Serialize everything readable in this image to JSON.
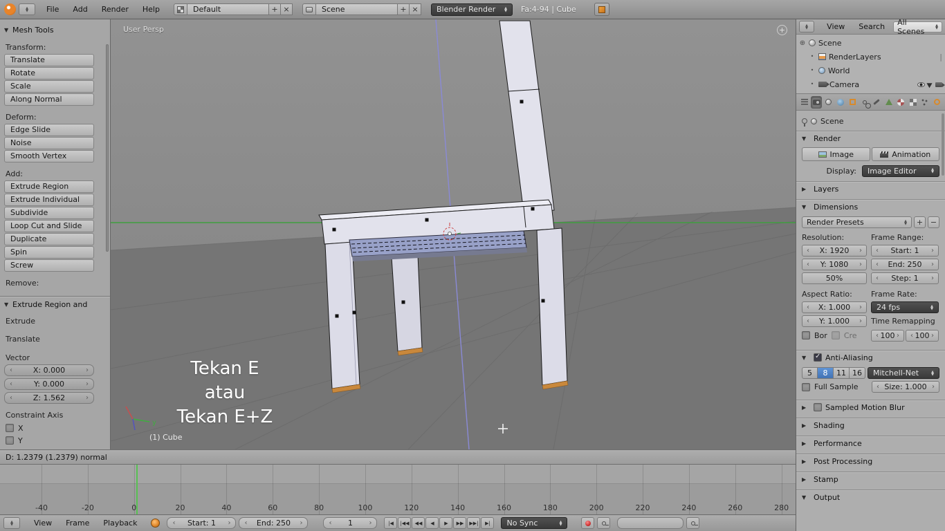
{
  "icons": {
    "panel_open": "▼",
    "panel_closed": "▶",
    "chevron_left": "‹",
    "chevron_right": "›",
    "plus": "+",
    "close": "×",
    "check": "✓"
  },
  "colors": {
    "accent_blue": "#4a7cc4",
    "selection_orange": "#c9883c",
    "axis_green": "#3e9e3e",
    "axis_blue": "#8a8ad6",
    "playhead_green": "#58c053",
    "record_red": "#c22727"
  },
  "top_bar": {
    "menus": [
      "File",
      "Add",
      "Render",
      "Help"
    ],
    "layout_name": "Default",
    "scene_name": "Scene",
    "engine": "Blender Render",
    "stats": "Fa:4-94 | Cube"
  },
  "tool_shelf": {
    "title": "Mesh Tools",
    "sections": [
      {
        "label": "Transform:",
        "buttons": [
          "Translate",
          "Rotate",
          "Scale",
          "Along Normal"
        ]
      },
      {
        "label": "Deform:",
        "buttons": [
          "Edge Slide",
          "Noise",
          "Smooth Vertex"
        ]
      },
      {
        "label": "Add:",
        "buttons": [
          "Extrude Region",
          "Extrude Individual",
          "Subdivide",
          "Loop Cut and Slide",
          "Duplicate",
          "Spin",
          "Screw"
        ]
      },
      {
        "label": "Remove:",
        "buttons": []
      }
    ],
    "operator_panel": {
      "title": "Extrude Region and",
      "op_label": "Extrude",
      "translate_label": "Translate",
      "vector_label": "Vector",
      "vector_x": "X: 0.000",
      "vector_y": "Y: 0.000",
      "vector_z": "Z: 1.562",
      "constraint_label": "Constraint Axis",
      "constraint_x": "X",
      "constraint_y": "Y"
    }
  },
  "viewport": {
    "view_label": "User Persp",
    "object_info": "(1) Cube",
    "overlay": [
      "Tekan E",
      "atau",
      "Tekan E+Z"
    ],
    "gizmo_y": "y"
  },
  "status_bar": {
    "text": "D: 1.2379 (1.2379) normal"
  },
  "timeline": {
    "ticks": [
      -40,
      -20,
      0,
      20,
      40,
      60,
      80,
      100,
      120,
      140,
      160,
      180,
      200,
      220,
      240,
      260,
      280
    ],
    "current_frame": "1",
    "menus": [
      "View",
      "Frame",
      "Playback"
    ],
    "start": "Start: 1",
    "end": "End: 250",
    "playback": [
      "|◀",
      "|◀◀",
      "◀◀",
      "◀",
      "▶",
      "▶▶",
      "▶▶|",
      "▶|"
    ],
    "sync": "No Sync"
  },
  "outliner": {
    "menus": [
      "View",
      "Search"
    ],
    "scope": "All Scenes",
    "items": [
      "Scene",
      "RenderLayers",
      "World",
      "Camera"
    ]
  },
  "properties": {
    "context": "Scene",
    "render": {
      "title": "Render",
      "image": "Image",
      "animation": "Animation",
      "display_label": "Display:",
      "display_value": "Image Editor"
    },
    "layers_title": "Layers",
    "dimensions": {
      "title": "Dimensions",
      "presets": "Render Presets",
      "resolution_label": "Resolution:",
      "frame_range_label": "Frame Range:",
      "res_x": "X: 1920",
      "res_y": "Y: 1080",
      "res_pct": "50%",
      "start": "Start: 1",
      "end": "End: 250",
      "step": "Step: 1",
      "aspect_label": "Aspect Ratio:",
      "framerate_label": "Frame Rate:",
      "asp_x": "X: 1.000",
      "asp_y": "Y: 1.000",
      "fps": "24 fps",
      "time_remap_label": "Time Remapping",
      "bor": "Bor",
      "cre": "Cre",
      "map_old": "100",
      "map_new": "100"
    },
    "antialiasing": {
      "title": "Anti-Aliasing",
      "samples": [
        "5",
        "8",
        "11",
        "16"
      ],
      "active": "8",
      "filter": "Mitchell-Net",
      "full_sample": "Full Sample",
      "size": "Size: 1.000"
    },
    "motion_blur_title": "Sampled Motion Blur",
    "collapsed": [
      "Shading",
      "Performance",
      "Post Processing",
      "Stamp"
    ],
    "output_title": "Output"
  }
}
